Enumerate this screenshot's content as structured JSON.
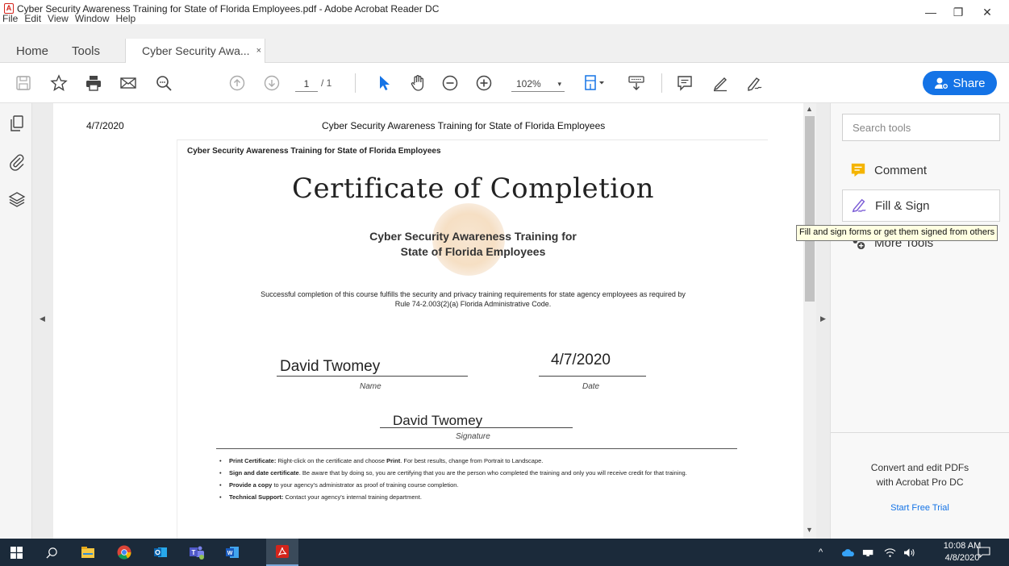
{
  "window": {
    "title": "Cyber Security Awareness Training for State of Florida Employees.pdf - Adobe Acrobat Reader DC",
    "pdf_badge": "A",
    "menu": [
      "File",
      "Edit",
      "View",
      "Window",
      "Help"
    ],
    "minimize": "—",
    "restore": "❐",
    "close": "✕"
  },
  "tabs": {
    "home": "Home",
    "tools": "Tools",
    "document": "Cyber Security Awa...",
    "close": "×"
  },
  "toolbar": {
    "page_current": "1",
    "page_total": "/ 1",
    "zoom": "102%",
    "zoom_caret": "▾",
    "share_label": "Share"
  },
  "document": {
    "header_date": "4/7/2020",
    "header_title": "Cyber Security Awareness Training for State of Florida Employees",
    "card_header": "Cyber Security Awareness Training for State of Florida Employees",
    "certificate_title": "Certificate of Completion",
    "course_line1": "Cyber Security Awareness Training for",
    "course_line2": "State of Florida Employees",
    "description": "Successful completion of this course fulfills the security and privacy training requirements for state agency employees as required by Rule 74-2.003(2)(a) Florida Administrative Code.",
    "name_value": "David Twomey",
    "name_label": "Name",
    "date_value": "4/7/2020",
    "date_label": "Date",
    "signature_value": "David Twomey",
    "signature_label": "Signature",
    "bullets": [
      {
        "bold": "Print Certificate:",
        "text": " Right-click on the certificate and choose ",
        "bold2": "Print",
        "text2": ". For best results, change from Portrait to Landscape."
      },
      {
        "bold": "Sign and date certificate",
        "text": ". Be aware that by doing so, you are certifying that you are the person who completed the training and only you will receive credit for that training.",
        "bold2": "",
        "text2": ""
      },
      {
        "bold": "Provide a copy",
        "text": " to your agency's administrator as proof of training course completion.",
        "bold2": "",
        "text2": ""
      },
      {
        "bold": "Technical Support:",
        "text": " Contact your agency's internal training department.",
        "bold2": "",
        "text2": ""
      }
    ]
  },
  "right_pane": {
    "search_placeholder": "Search tools",
    "comment": "Comment",
    "fill_sign": "Fill & Sign",
    "more_tools": "More Tools",
    "tooltip": "Fill and sign forms or get them signed from others",
    "promo_line1": "Convert and edit PDFs",
    "promo_line2": "with Acrobat Pro DC",
    "promo_link": "Start Free Trial"
  },
  "taskbar": {
    "time": "10:08 AM",
    "date": "4/8/2020",
    "tray_caret": "^"
  },
  "colors": {
    "accent": "#1473e6",
    "comment_icon": "#f4b400",
    "fill_sign_icon": "#7b5cd6",
    "taskbar": "#1b2a3a"
  }
}
